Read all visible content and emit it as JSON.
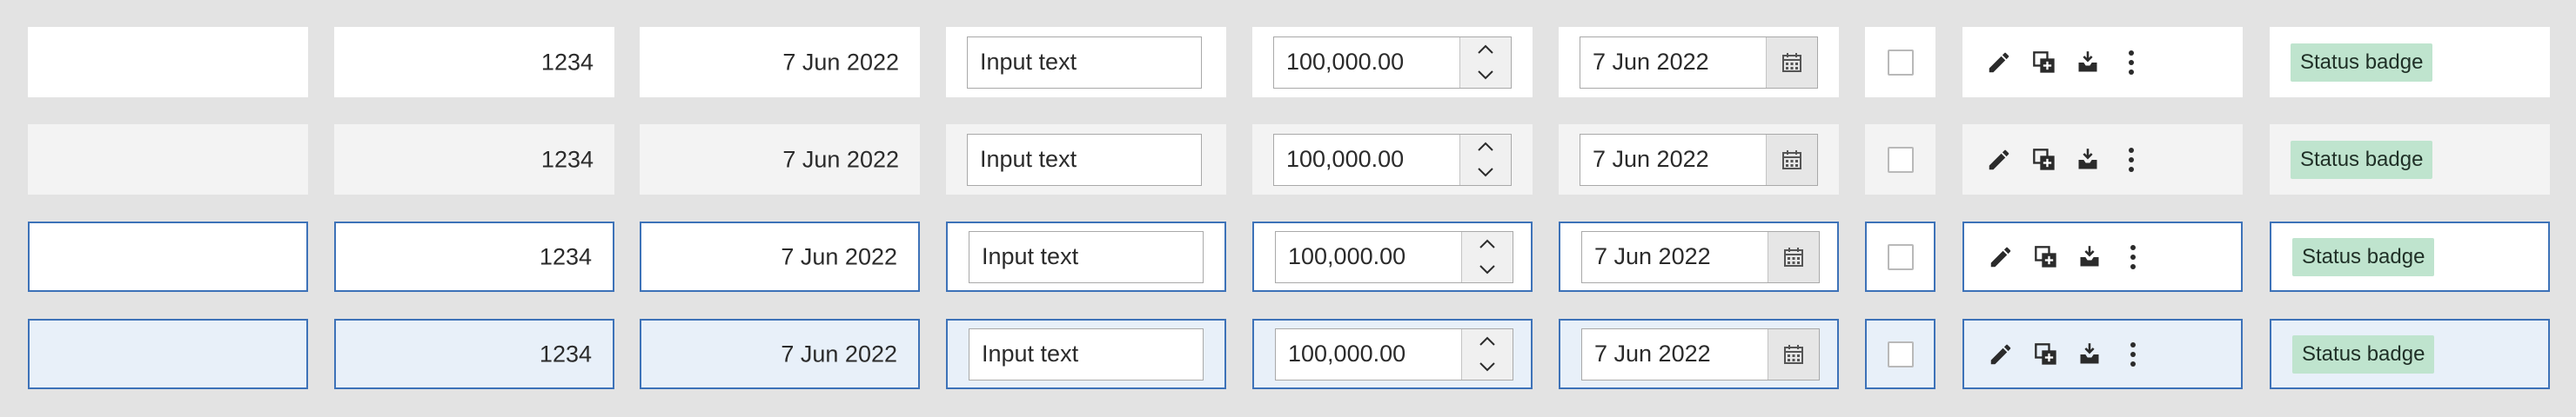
{
  "rows": [
    {
      "variant": "default",
      "number": "1234",
      "date": "7 Jun 2022",
      "input_value": "Input text",
      "stepper_value": "100,000.00",
      "datepicker_value": "7 Jun 2022",
      "badge": "Status badge"
    },
    {
      "variant": "disabled",
      "number": "1234",
      "date": "7 Jun 2022",
      "input_value": "Input text",
      "stepper_value": "100,000.00",
      "datepicker_value": "7 Jun 2022",
      "badge": "Status badge"
    },
    {
      "variant": "selected",
      "number": "1234",
      "date": "7 Jun 2022",
      "input_value": "Input text",
      "stepper_value": "100,000.00",
      "datepicker_value": "7 Jun 2022",
      "badge": "Status badge"
    },
    {
      "variant": "selected-hover",
      "number": "1234",
      "date": "7 Jun 2022",
      "input_value": "Input text",
      "stepper_value": "100,000.00",
      "datepicker_value": "7 Jun 2022",
      "badge": "Status badge"
    }
  ],
  "icons": {
    "stepper_up": "chevron-up-icon",
    "stepper_down": "chevron-down-icon",
    "calendar": "calendar-icon",
    "actions": [
      "pencil-icon",
      "duplicate-icon",
      "inbox-download-icon",
      "more-vertical-icon"
    ]
  },
  "colors": {
    "background": "#e3e3e3",
    "cell": "#ffffff",
    "cell_disabled": "#f3f3f3",
    "selected_border": "#3d72b8",
    "selected_hover_fill": "#e8f0f9",
    "badge_fill": "#bfe4ce",
    "icon": "#2b2b2b"
  }
}
